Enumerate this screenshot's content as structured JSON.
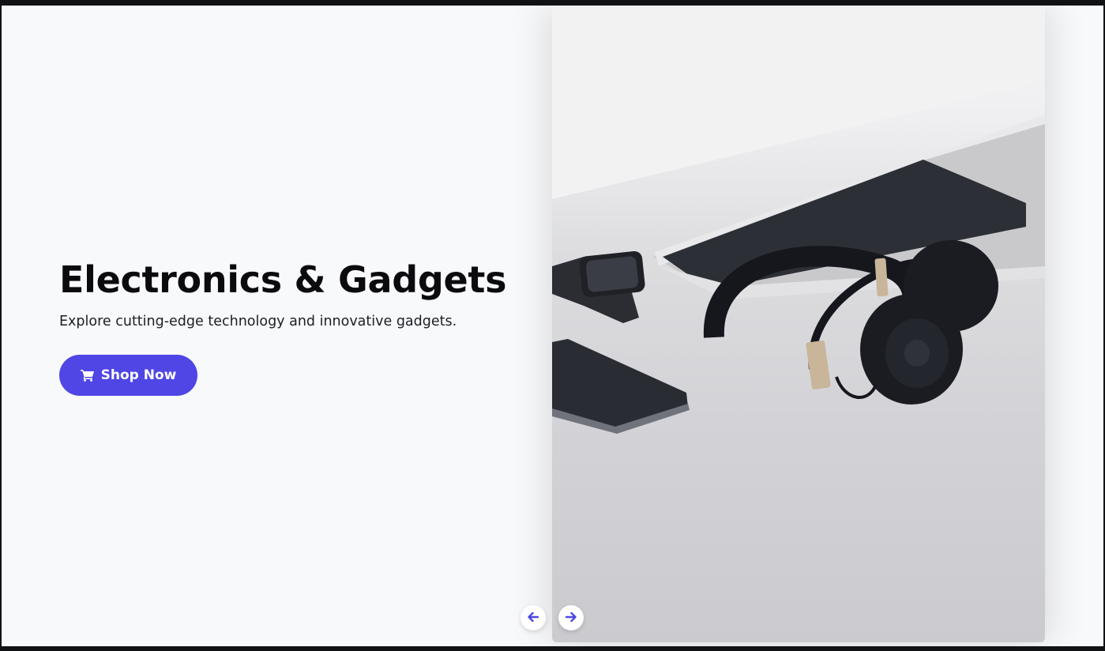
{
  "hero": {
    "title": "Electronics & Gadgets",
    "subtitle": "Explore cutting-edge technology and innovative gadgets.",
    "cta_label": "Shop Now",
    "cta_icon": "cart-icon"
  },
  "carousel": {
    "image_subject": "headphones-laptop-watch-phone",
    "prev_icon": "arrow-left-icon",
    "next_icon": "arrow-right-icon"
  },
  "colors": {
    "accent": "#4f46e5",
    "background": "#f8f9fb",
    "title": "#0b0b0f"
  }
}
